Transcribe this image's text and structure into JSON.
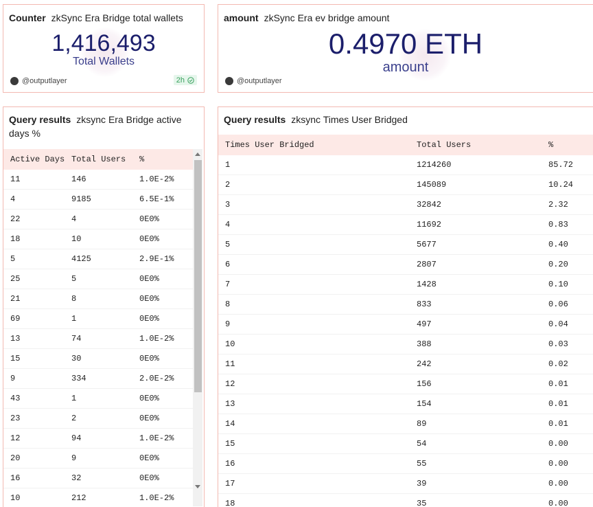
{
  "counter_card": {
    "kind": "Counter",
    "title": "zkSync Era Bridge total wallets",
    "value": "1,416,493",
    "label": "Total Wallets",
    "author": "@outputlayer",
    "badge": "2h"
  },
  "amount_card": {
    "kind": "amount",
    "title": "zkSync Era ev bridge amount",
    "value": "0.4970 ETH",
    "label": "amount",
    "author": "@outputlayer"
  },
  "active_days_card": {
    "kind": "Query results",
    "title": "zksync Era Bridge active days %",
    "columns": [
      "Active Days",
      "Total Users",
      "%"
    ],
    "rows": [
      [
        "11",
        "146",
        "1.0E-2%"
      ],
      [
        "4",
        "9185",
        "6.5E-1%"
      ],
      [
        "22",
        "4",
        "0E0%"
      ],
      [
        "18",
        "10",
        "0E0%"
      ],
      [
        "5",
        "4125",
        "2.9E-1%"
      ],
      [
        "25",
        "5",
        "0E0%"
      ],
      [
        "21",
        "8",
        "0E0%"
      ],
      [
        "69",
        "1",
        "0E0%"
      ],
      [
        "13",
        "74",
        "1.0E-2%"
      ],
      [
        "15",
        "30",
        "0E0%"
      ],
      [
        "9",
        "334",
        "2.0E-2%"
      ],
      [
        "43",
        "1",
        "0E0%"
      ],
      [
        "23",
        "2",
        "0E0%"
      ],
      [
        "12",
        "94",
        "1.0E-2%"
      ],
      [
        "20",
        "9",
        "0E0%"
      ],
      [
        "16",
        "32",
        "0E0%"
      ],
      [
        "10",
        "212",
        "1.0E-2%"
      ]
    ]
  },
  "times_bridged_card": {
    "kind": "Query results",
    "title": "zksync Times User Bridged",
    "columns": [
      "Times User Bridged",
      "Total Users",
      "%"
    ],
    "rows": [
      [
        "1",
        "1214260",
        "85.72"
      ],
      [
        "2",
        "145089",
        "10.24"
      ],
      [
        "3",
        "32842",
        "2.32"
      ],
      [
        "4",
        "11692",
        "0.83"
      ],
      [
        "5",
        "5677",
        "0.40"
      ],
      [
        "6",
        "2807",
        "0.20"
      ],
      [
        "7",
        "1428",
        "0.10"
      ],
      [
        "8",
        "833",
        "0.06"
      ],
      [
        "9",
        "497",
        "0.04"
      ],
      [
        "10",
        "388",
        "0.03"
      ],
      [
        "11",
        "242",
        "0.02"
      ],
      [
        "12",
        "156",
        "0.01"
      ],
      [
        "13",
        "154",
        "0.01"
      ],
      [
        "14",
        "89",
        "0.01"
      ],
      [
        "15",
        "54",
        "0.00"
      ],
      [
        "16",
        "55",
        "0.00"
      ],
      [
        "17",
        "39",
        "0.00"
      ],
      [
        "18",
        "35",
        "0.00"
      ]
    ]
  }
}
